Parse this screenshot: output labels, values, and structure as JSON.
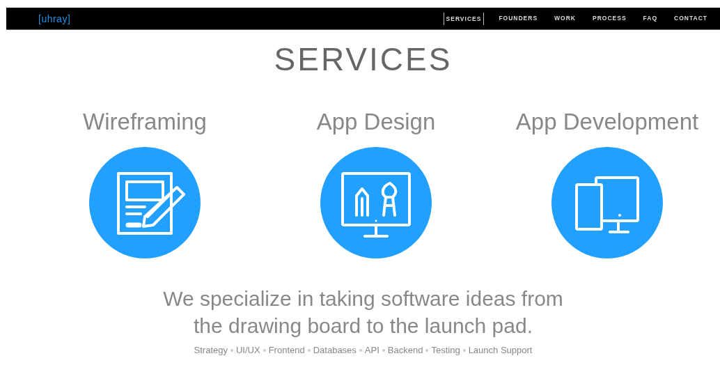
{
  "header": {
    "logo": "[uhray]",
    "nav": [
      {
        "label": "SERVICES",
        "selected": true
      },
      {
        "label": "FOUNDERS",
        "selected": false
      },
      {
        "label": "WORK",
        "selected": false
      },
      {
        "label": "PROCESS",
        "selected": false
      },
      {
        "label": "FAQ",
        "selected": false
      },
      {
        "label": "CONTACT",
        "selected": false
      }
    ]
  },
  "title": "SERVICES",
  "services": [
    {
      "title": "Wireframing",
      "kind": "wireframe"
    },
    {
      "title": "App Design",
      "kind": "design"
    },
    {
      "title": "App Development",
      "kind": "development"
    }
  ],
  "tagline": [
    "We specialize in taking software ideas from",
    "the drawing board to the launch pad."
  ],
  "skills": [
    "Strategy",
    "UI/UX",
    "Frontend",
    "Databases",
    "API",
    "Backend",
    "Testing",
    "Launch Support"
  ]
}
